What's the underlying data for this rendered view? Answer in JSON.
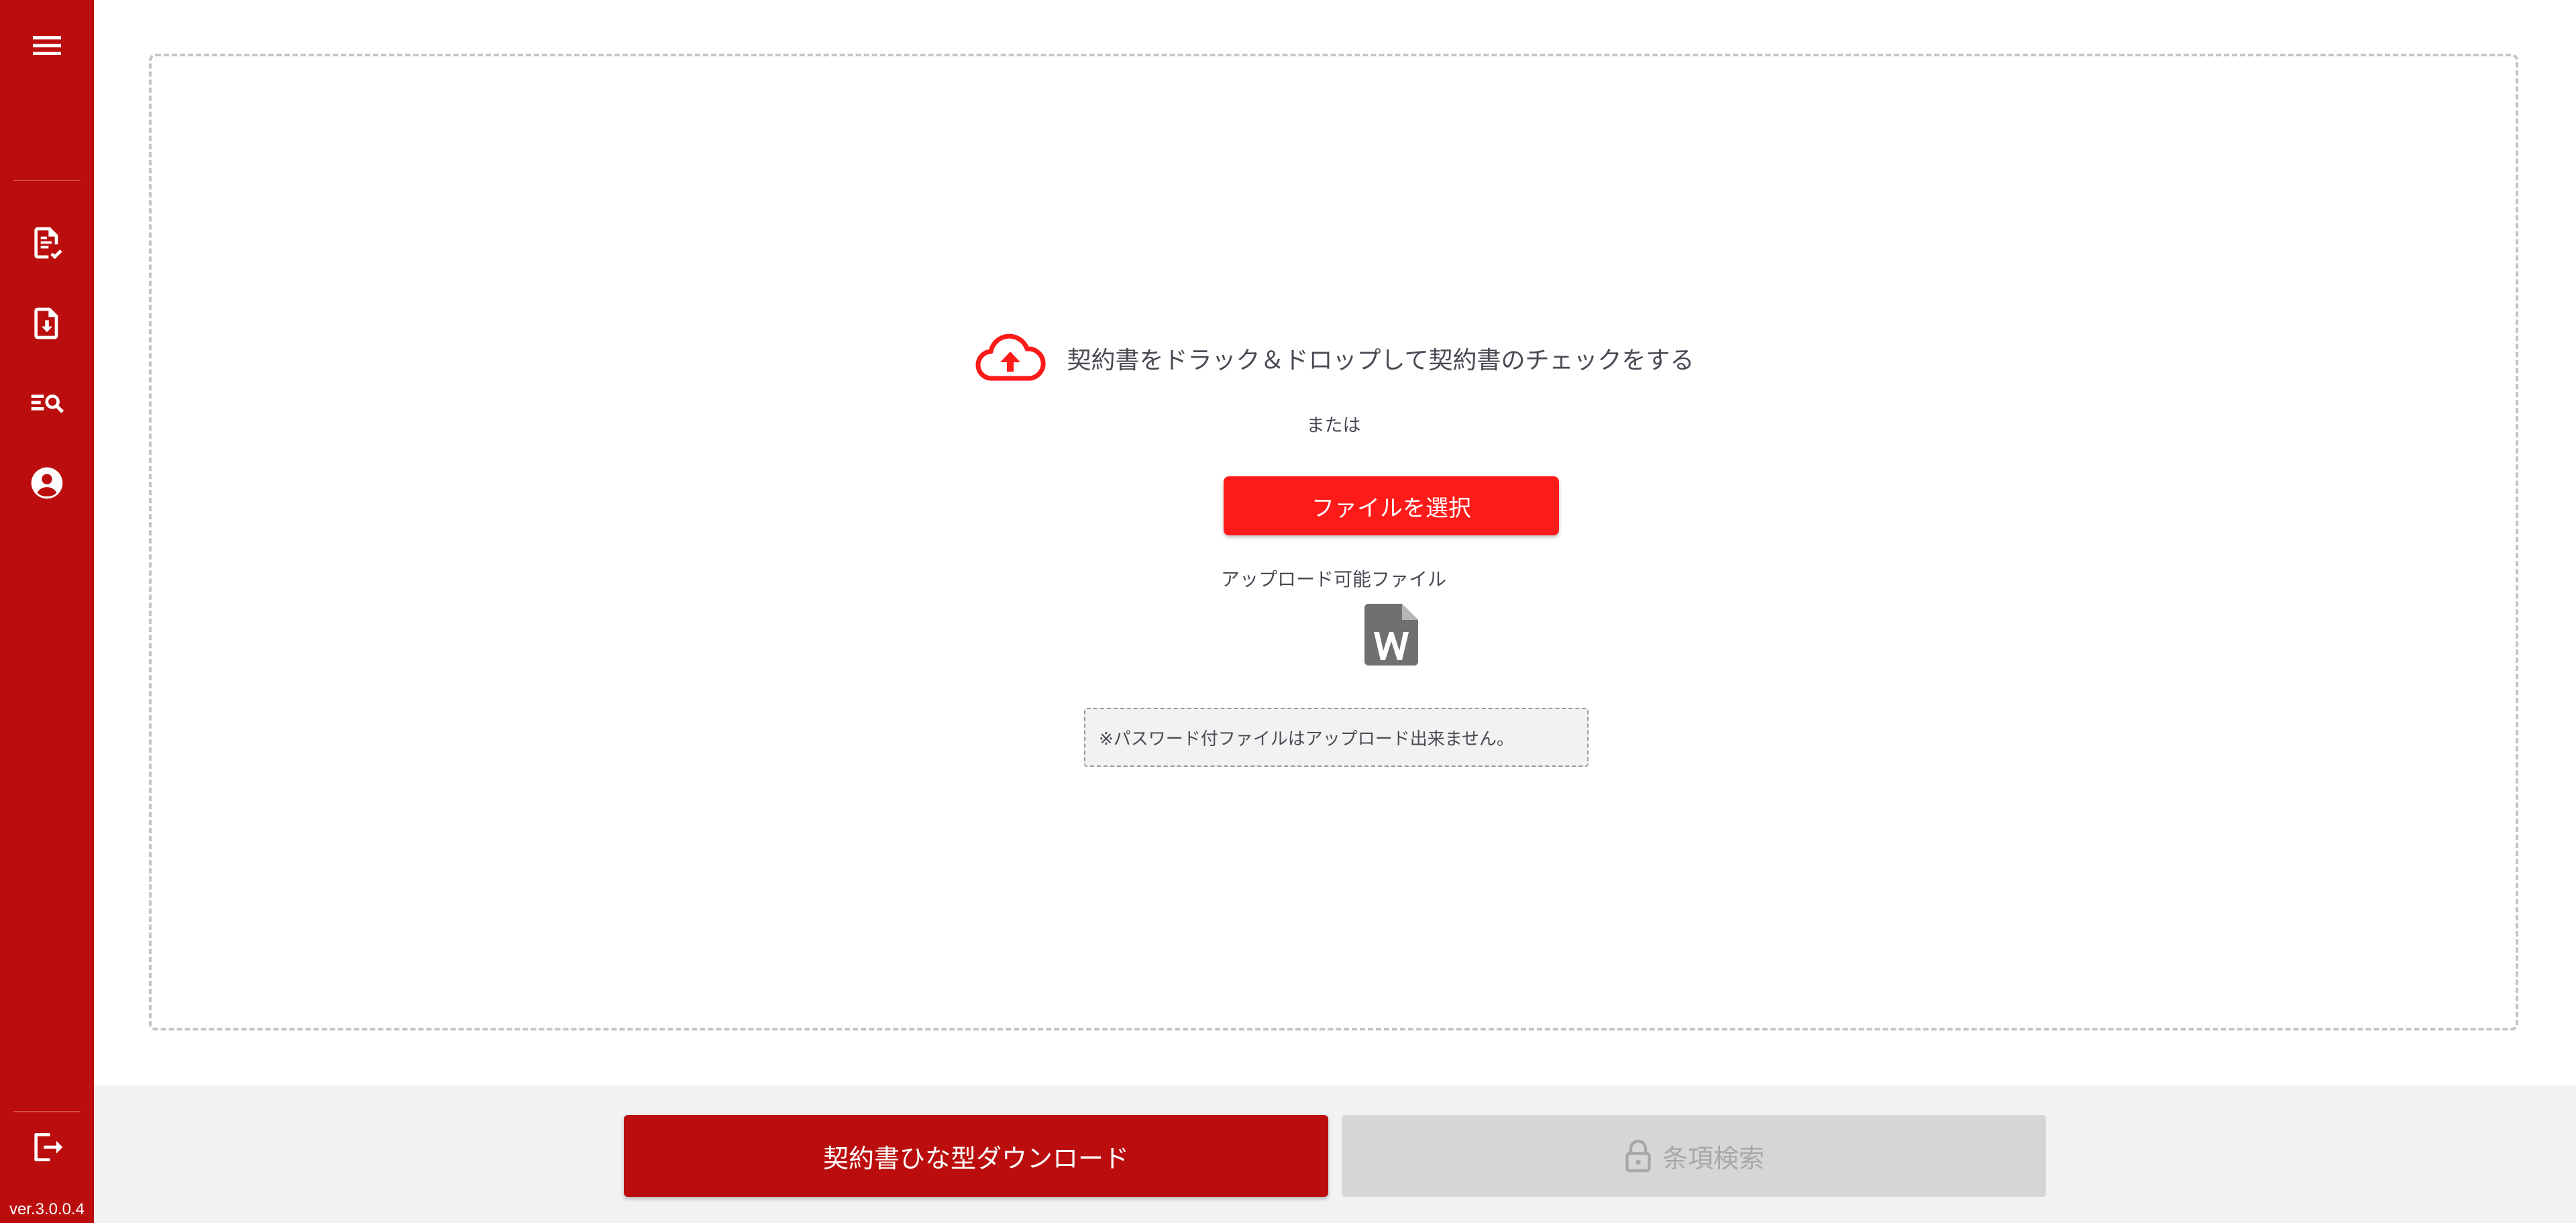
{
  "sidebar": {
    "icons": [
      "menu-icon",
      "document-check-icon",
      "document-download-icon",
      "list-search-icon",
      "account-circle-icon",
      "logout-icon"
    ],
    "version": "ver.3.0.0.4"
  },
  "upload": {
    "title": "契約書をドラック＆ドロップして契約書のチェックをする",
    "or_text": "または",
    "select_button": "ファイルを選択",
    "types_label": "アップロード可能ファイル",
    "note": "※パスワード付ファイルはアップロード出来ません。"
  },
  "footer": {
    "download_button": "契約書ひな型ダウンロード",
    "search_button": "条項検索",
    "search_enabled": false
  },
  "colors": {
    "sidebar": "#bb0d0d",
    "accent": "#ff1a1a",
    "disabled": "#d6d6d6"
  }
}
